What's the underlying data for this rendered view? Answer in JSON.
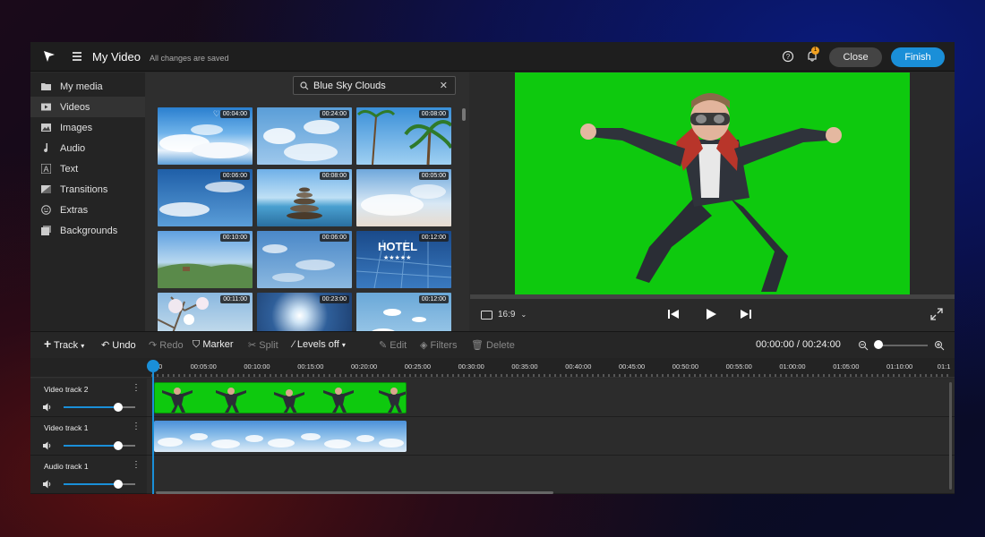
{
  "header": {
    "title": "My Video",
    "saved_status": "All changes are saved",
    "notification_count": "1",
    "close_label": "Close",
    "finish_label": "Finish"
  },
  "sidebar": {
    "items": [
      {
        "label": "My media",
        "icon": "folder-icon"
      },
      {
        "label": "Videos",
        "icon": "video-icon"
      },
      {
        "label": "Images",
        "icon": "image-icon"
      },
      {
        "label": "Audio",
        "icon": "music-note-icon"
      },
      {
        "label": "Text",
        "icon": "text-icon"
      },
      {
        "label": "Transitions",
        "icon": "transition-icon"
      },
      {
        "label": "Extras",
        "icon": "smiley-icon"
      },
      {
        "label": "Backgrounds",
        "icon": "background-icon"
      }
    ]
  },
  "media": {
    "search_value": "Blue Sky Clouds",
    "thumbnails": [
      {
        "duration": "00:04:00"
      },
      {
        "duration": "00:24:00"
      },
      {
        "duration": "00:08:00"
      },
      {
        "duration": "00:06:00"
      },
      {
        "duration": "00:08:00"
      },
      {
        "duration": "00:05:00"
      },
      {
        "duration": "00:10:00"
      },
      {
        "duration": "00:06:00"
      },
      {
        "duration": "00:12:00"
      },
      {
        "duration": "00:11:00"
      },
      {
        "duration": "00:23:00"
      },
      {
        "duration": "00:12:00"
      }
    ]
  },
  "preview": {
    "aspect_ratio": "16:9"
  },
  "toolbar": {
    "track": "Track",
    "undo": "Undo",
    "redo": "Redo",
    "marker": "Marker",
    "split": "Split",
    "levels": "Levels off",
    "edit": "Edit",
    "filters": "Filters",
    "delete": "Delete",
    "time": "00:00:00 / 00:24:00"
  },
  "ruler": {
    "ticks": [
      "00",
      "00:05:00",
      "00:10:00",
      "00:15:00",
      "00:20:00",
      "00:25:00",
      "00:30:00",
      "00:35:00",
      "00:40:00",
      "00:45:00",
      "00:50:00",
      "00:55:00",
      "01:00:00",
      "01:05:00",
      "01:10:00",
      "01:1"
    ]
  },
  "tracks": [
    {
      "name": "Video track 2"
    },
    {
      "name": "Video track 1"
    },
    {
      "name": "Audio track 1"
    }
  ],
  "colors": {
    "accent": "#1a8fd8",
    "chroma_green": "#0ec90e"
  }
}
